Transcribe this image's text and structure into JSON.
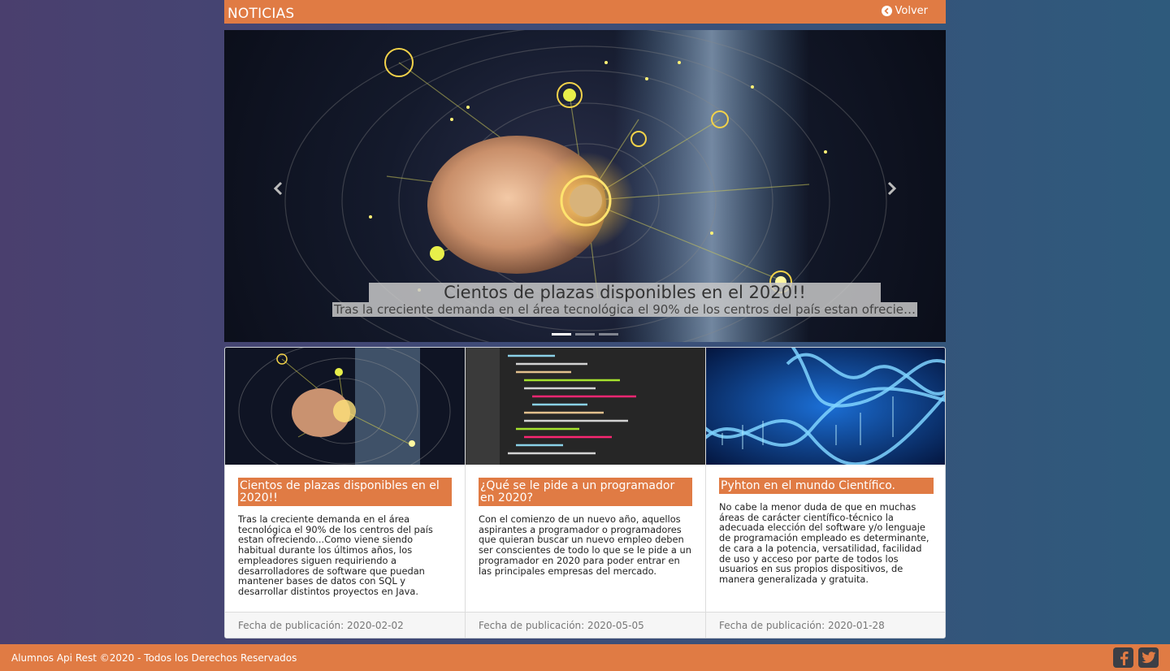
{
  "header": {
    "title": "NOTICIAS",
    "back_label": "Volver"
  },
  "carousel": {
    "slides_count": 3,
    "active_index": 0,
    "caption_title": "Cientos de plazas disponibles en el 2020!!",
    "caption_text": "Tras la creciente demanda en el área tecnológica el 90% de los centros del país estan ofreciendo...Como viene siendo habitual"
  },
  "cards": [
    {
      "title": "Cientos de plazas disponibles en el 2020!!",
      "text": "Tras la creciente demanda en el área tecnológica el 90% de los centros del país estan ofreciendo...Como viene siendo habitual durante los últimos años, los empleadores siguen requiriendo a desarrolladores de software que puedan mantener bases de datos con SQL y desarrollar distintos proyectos en Java.",
      "date": "Fecha de publicación: 2020-02-02"
    },
    {
      "title": "¿Qué se le pide a un programador en 2020?",
      "text": "Con el comienzo de un nuevo año, aquellos aspirantes a programador o programadores que quieran buscar un nuevo empleo deben ser conscientes de todo lo que se le pide a un programador en 2020 para poder entrar en las principales empresas del mercado.",
      "date": "Fecha de publicación: 2020-05-05"
    },
    {
      "title": "Pyhton en el mundo Científico.",
      "text": "No cabe la menor duda de que en muchas áreas de carácter científico-técnico la adecuada elección del software y/o lenguaje de programación empleado es determinante, de cara a la potencia, versatilidad, facilidad de uso y acceso por parte de todos los usuarios en sus propios dispositivos, de manera generalizada y gratuita.",
      "date": "Fecha de publicación: 2020-01-28"
    }
  ],
  "footer": {
    "copyright": "Alumnos Api Rest ©2020 - Todos los Derechos Reservados"
  },
  "social": [
    "facebook-icon",
    "twitter-icon"
  ],
  "colors": {
    "accent": "#e07b44",
    "footer_bg": "#f6f6f6",
    "icon_bg": "#3b3f46"
  }
}
